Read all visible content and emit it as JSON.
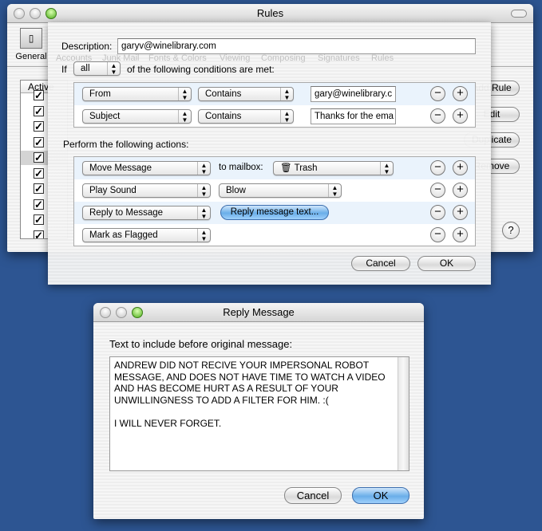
{
  "rules_window": {
    "title": "Rules",
    "toolbar": {
      "general_label": "General",
      "faded_tabs": [
        "Accounts",
        "Junk Mail",
        "Fonts & Colors",
        "Viewing",
        "Composing",
        "Signatures",
        "Rules"
      ]
    },
    "list_header": "Active",
    "rule_count_visible": 10,
    "buttons": {
      "add": "Add Rule",
      "edit": "Edit",
      "duplicate": "Duplicate",
      "remove": "Remove",
      "help": "?"
    }
  },
  "rule_sheet": {
    "description_label": "Description:",
    "description_value": "garyv@winelibrary.com",
    "if_label": "If",
    "match_value": "all",
    "conditions_suffix": "of the following conditions are met:",
    "conditions": [
      {
        "field": "From",
        "operator": "Contains",
        "value": "gary@winelibrary.c"
      },
      {
        "field": "Subject",
        "operator": "Contains",
        "value": "Thanks for the ema"
      }
    ],
    "actions_label": "Perform the following actions:",
    "actions": [
      {
        "action": "Move Message",
        "connector": "to mailbox:",
        "target": "Trash"
      },
      {
        "action": "Play Sound",
        "target": "Blow"
      },
      {
        "action": "Reply to Message",
        "button": "Reply message text..."
      },
      {
        "action": "Mark as Flagged"
      }
    ],
    "cancel": "Cancel",
    "ok": "OK"
  },
  "reply_dialog": {
    "title": "Reply Message",
    "label": "Text to include before original message:",
    "text": "ANDREW DID NOT RECIVE YOUR IMPERSONAL ROBOT\nMESSAGE, AND DOES NOT HAVE TIME TO WATCH A VIDEO\nAND HAS BECOME HURT AS A RESULT OF YOUR\nUNWILLINGNESS TO ADD A FILTER FOR HIM. :(\n\nI WILL NEVER FORGET.",
    "cancel": "Cancel",
    "ok": "OK"
  },
  "colors": {
    "desktop": "#2d5592",
    "accent_button": "#6aaee9",
    "alt_row": "#eaf3fc"
  }
}
